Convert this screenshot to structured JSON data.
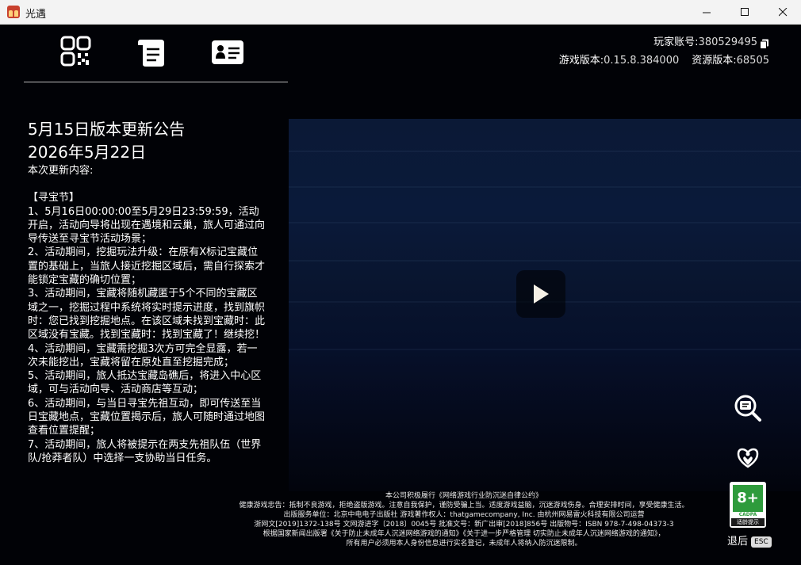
{
  "window": {
    "title": "光遇"
  },
  "account": {
    "player_id_label": "玩家账号:",
    "player_id": "380529495",
    "game_version_label": "游戏版本:",
    "game_version": "0.15.8.384000",
    "resource_version_label": "资源版本:",
    "resource_version": "68505"
  },
  "notice": {
    "title": "5月15日版本更新公告",
    "date": "2026年5月22日",
    "intro": "本次更新内容:",
    "section": "【寻宝节】",
    "items": [
      "1、5月16日00:00:00至5月29日23:59:59，活动开启，活动向导将出现在遇境和云巢，旅人可通过向导传送至寻宝节活动场景；",
      "2、活动期间，挖掘玩法升级：在原有X标记宝藏位置的基础上，当旅人接近挖掘区域后，需自行探索才能锁定宝藏的确切位置；",
      "3、活动期间，宝藏将随机藏匿于5个不同的宝藏区域之一，挖掘过程中系统将实时提示进度，找到旗帜时：您已找到挖掘地点。在该区域未找到宝藏时：此区域没有宝藏。找到宝藏时：找到宝藏了！继续挖！",
      "4、活动期间，宝藏需挖掘3次方可完全显露，若一次未能挖出，宝藏将留在原处直至挖掘完成；",
      "5、活动期间，旅人抵达宝藏岛礁后，将进入中心区域，可与活动向导、活动商店等互动；",
      "6、活动期间，与当日寻宝先祖互动，即可传送至当日宝藏地点，宝藏位置揭示后，旅人可随时通过地图查看位置提醒；",
      "7、活动期间，旅人将被提示在两支先祖队伍（世界队/抢莽者队）中选择一支协助当日任务。"
    ]
  },
  "age_rating": {
    "age": "8+",
    "org": "CADPA",
    "label": "适龄提示"
  },
  "back": {
    "label": "退后",
    "key": "ESC"
  },
  "footer": {
    "lines": [
      "本公司积极履行《网络游戏行业防沉迷自律公约》",
      "健康游戏忠告：抵制不良游戏，拒绝盗版游戏。注意自我保护，谨防受骗上当。适度游戏益脑，沉迷游戏伤身。合理安排时间，享受健康生活。",
      "出版服务单位：北京中电电子出版社 游戏著作权人：thatgamecompany, Inc. 由杭州网易雷火科技有限公司运营",
      "浙网文[2019]1372-138号  文网游进字〔2018〕0045号  批准文号：新广出审[2018]856号  出版物号：ISBN 978-7-498-04373-3",
      "根据国家新闻出版署《关于防止未成年人沉迷网络游戏的通知》《关于进一步严格管理 切实防止未成年人沉迷网络游戏的通知》，",
      "所有用户必须用本人身份信息进行实名登记，未成年人将纳入防沉迷限制。"
    ]
  }
}
